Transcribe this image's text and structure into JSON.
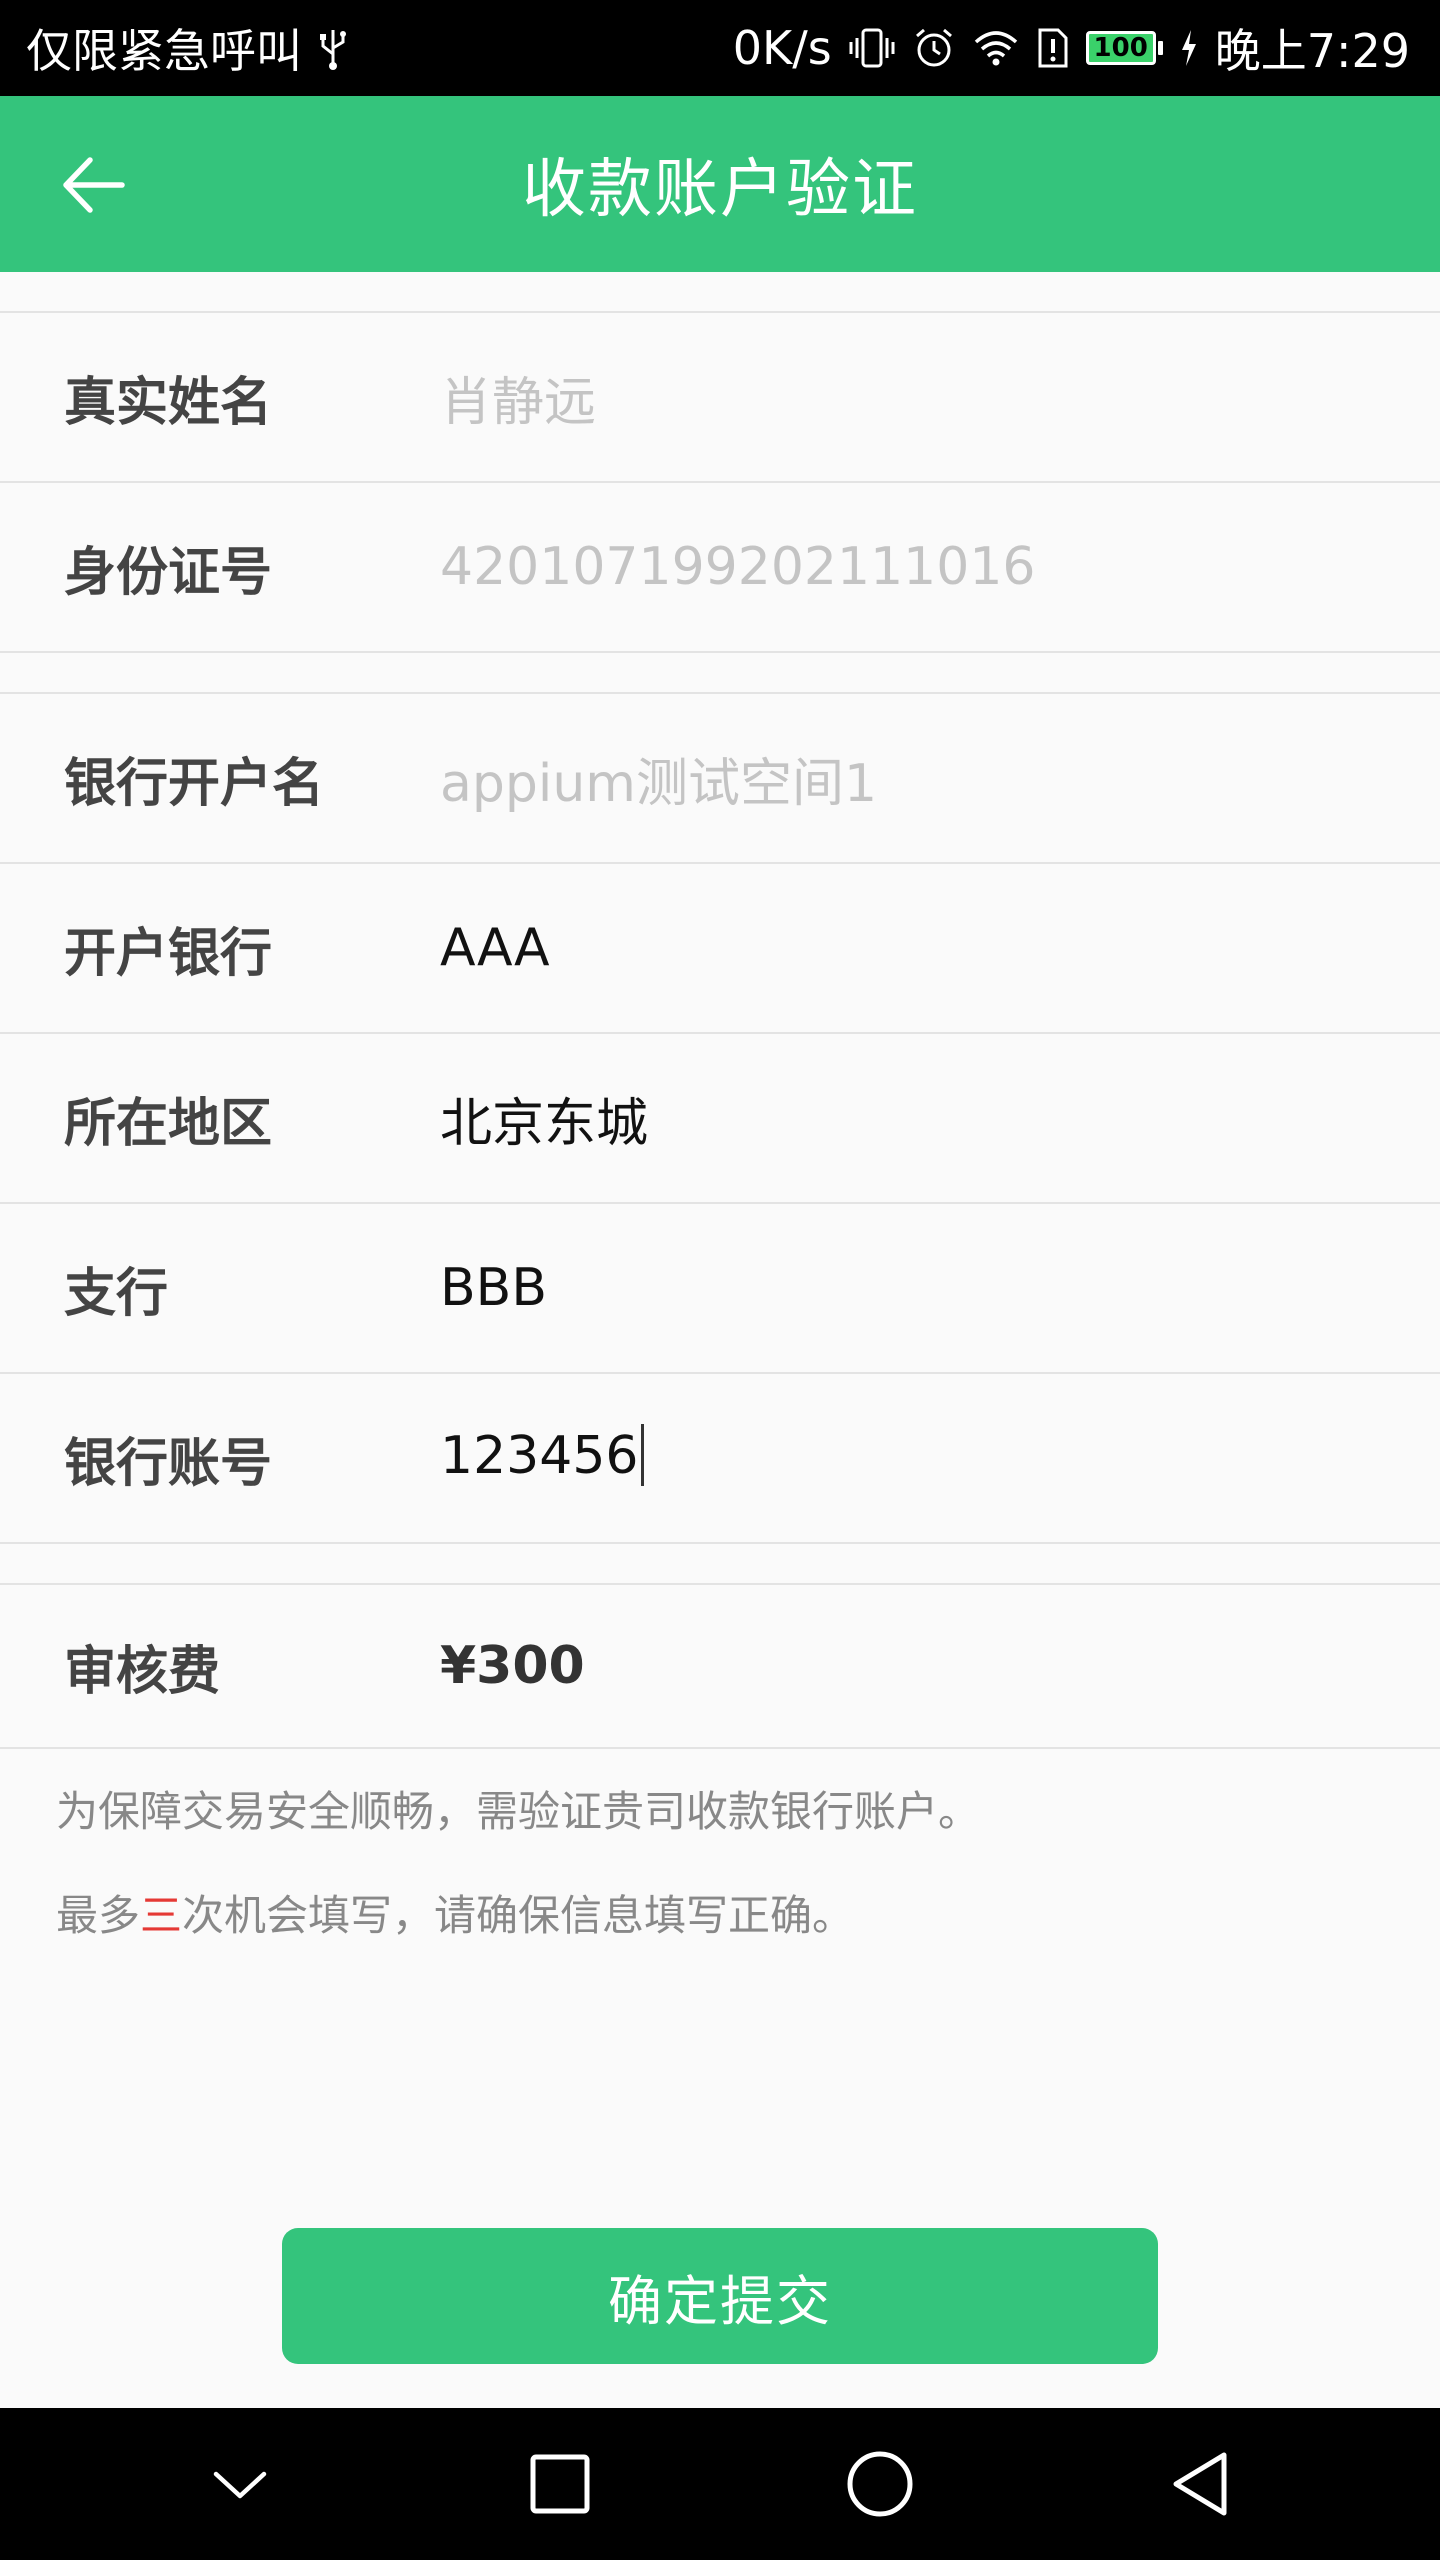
{
  "status_bar": {
    "carrier_text": "仅限紧急呼叫",
    "network_speed": "0K/s",
    "battery_level": "100",
    "time": "晚上7:29"
  },
  "header": {
    "title": "收款账户验证"
  },
  "identity": {
    "name_label": "真实姓名",
    "name_value": "肖静远",
    "id_label": "身份证号",
    "id_value": "420107199202111016"
  },
  "bank": {
    "account_name_label": "银行开户名",
    "account_name_value": "appium测试空间1",
    "bank_label": "开户银行",
    "bank_value": "AAA",
    "region_label": "所在地区",
    "region_value": "北京东城",
    "branch_label": "支行",
    "branch_value": "BBB",
    "account_no_label": "银行账号",
    "account_no_value": "123456"
  },
  "fee": {
    "label": "审核费",
    "value": "¥300"
  },
  "notes": {
    "line1": "为保障交易安全顺畅，需验证贵司收款银行账户。",
    "line2_prefix": "最多",
    "line2_highlight": "三",
    "line2_suffix": "次机会填写，请确保信息填写正确。"
  },
  "submit_label": "确定提交",
  "colors": {
    "primary": "#34c47c",
    "highlight": "#e53935",
    "placeholder": "#c4c4c4"
  }
}
